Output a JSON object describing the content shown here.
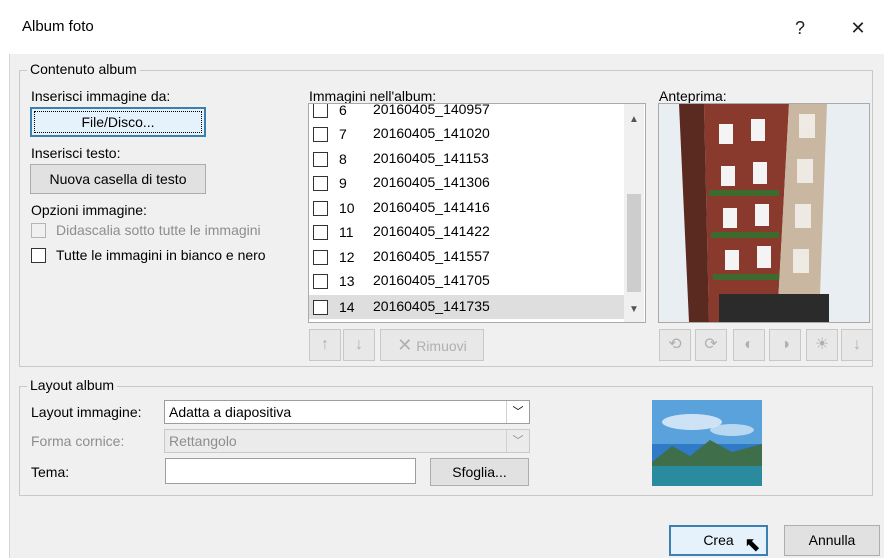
{
  "window": {
    "title": "Album foto",
    "help_label": "?",
    "close_label": "✕"
  },
  "contenuto": {
    "legend": "Contenuto album",
    "insert_image_label": "Inserisci immagine da:",
    "file_disk_button": "File/Disco...",
    "insert_text_label": "Inserisci testo:",
    "new_textbox_button": "Nuova casella di testo",
    "image_options_label": "Opzioni immagine:",
    "captions_option": "Didascalia sotto tutte le immagini",
    "bw_option": "Tutte le immagini in bianco e nero"
  },
  "album_list": {
    "label": "Immagini nell'album:",
    "items": [
      {
        "num": "6",
        "name": "20160405_140957",
        "selected": false
      },
      {
        "num": "7",
        "name": "20160405_141020",
        "selected": false
      },
      {
        "num": "8",
        "name": "20160405_141153",
        "selected": false
      },
      {
        "num": "9",
        "name": "20160405_141306",
        "selected": false
      },
      {
        "num": "10",
        "name": "20160405_141416",
        "selected": false
      },
      {
        "num": "11",
        "name": "20160405_141422",
        "selected": false
      },
      {
        "num": "12",
        "name": "20160405_141557",
        "selected": false
      },
      {
        "num": "13",
        "name": "20160405_141705",
        "selected": false
      },
      {
        "num": "14",
        "name": "20160405_141735",
        "selected": true
      }
    ],
    "move_up_icon": "arrow-up-icon",
    "move_down_icon": "arrow-down-icon",
    "remove_button": "Rimuovi"
  },
  "preview": {
    "label": "Anteprima:",
    "tools": [
      "rotate-left-icon",
      "rotate-right-icon",
      "contrast-up-icon",
      "contrast-down-icon",
      "brightness-up-icon",
      "brightness-down-icon"
    ]
  },
  "layout": {
    "legend": "Layout album",
    "image_layout_label": "Layout immagine:",
    "image_layout_value": "Adatta a diapositiva",
    "frame_shape_label": "Forma cornice:",
    "frame_shape_value": "Rettangolo",
    "theme_label": "Tema:",
    "theme_value": "",
    "browse_button": "Sfoglia..."
  },
  "footer": {
    "create_button": "Crea",
    "cancel_button": "Annulla"
  }
}
